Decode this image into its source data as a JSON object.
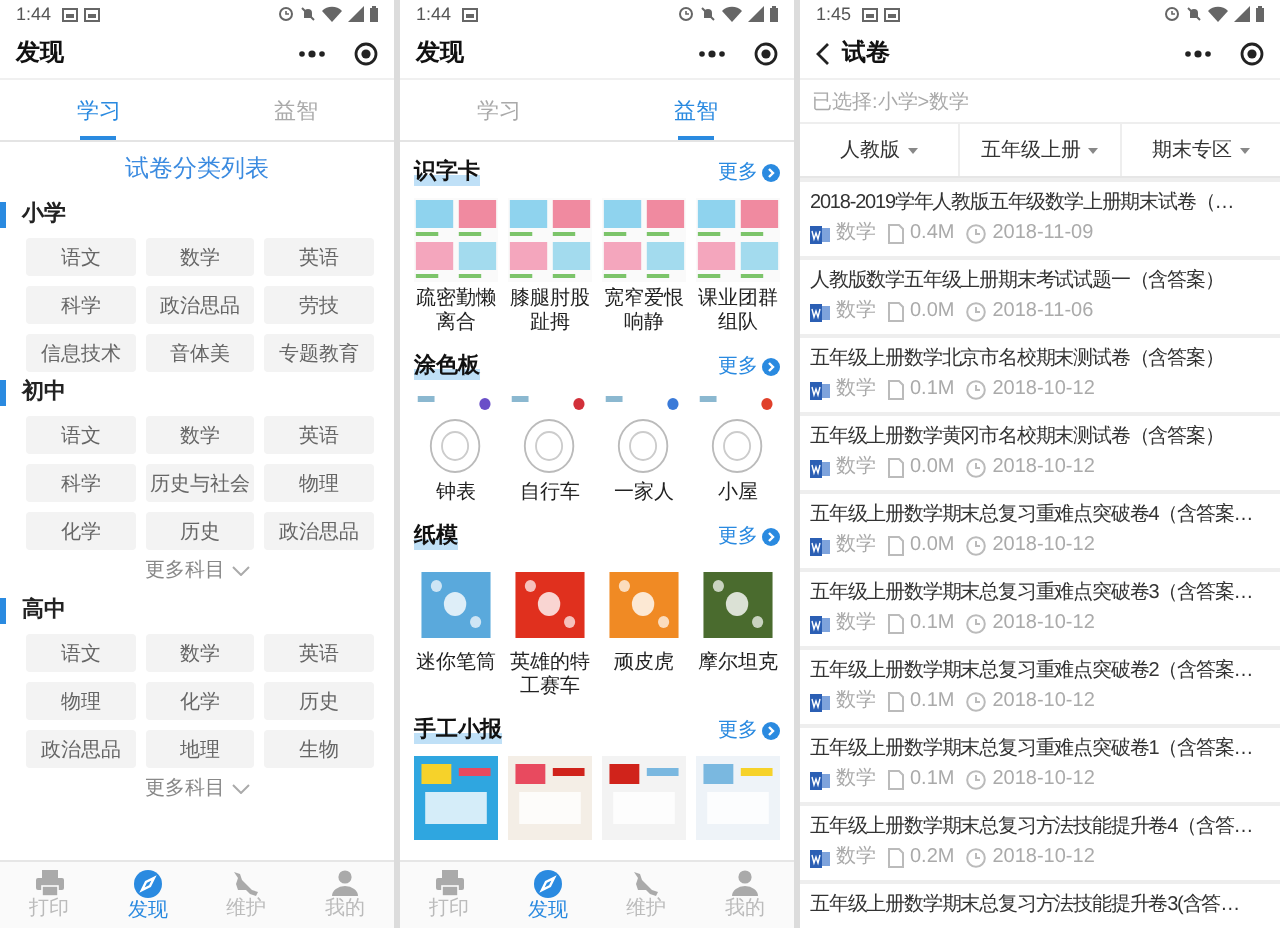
{
  "screens": [
    {
      "kind": "study",
      "status_bar": {
        "time": "1:44",
        "notices": [
          {
            "kind": "gallery"
          },
          {
            "kind": "gallery"
          }
        ]
      },
      "nav": {
        "title": "发现"
      },
      "tabs": [
        {
          "label": "学习",
          "selected": true
        },
        {
          "label": "益智",
          "selected": false
        }
      ],
      "heading": "试卷分类列表",
      "sections": [
        {
          "title": "小学",
          "subjects": [
            "语文",
            "数学",
            "英语",
            "科学",
            "政治思品",
            "劳技",
            "信息技术",
            "音体美",
            "专题教育"
          ]
        },
        {
          "title": "初中",
          "subjects": [
            "语文",
            "数学",
            "英语",
            "科学",
            "历史与社会",
            "物理",
            "化学",
            "历史",
            "政治思品"
          ],
          "more": "更多科目"
        },
        {
          "title": "高中",
          "subjects": [
            "语文",
            "数学",
            "英语",
            "物理",
            "化学",
            "历史",
            "政治思品",
            "地理",
            "生物"
          ],
          "more": "更多科目"
        }
      ],
      "bottom_tabs": [
        {
          "label": "打印",
          "selected": false
        },
        {
          "label": "发现",
          "selected": true
        },
        {
          "label": "维护",
          "selected": false
        },
        {
          "label": "我的",
          "selected": false
        }
      ]
    },
    {
      "kind": "puzzle",
      "status_bar": {
        "time": "1:44",
        "notices": [
          {
            "kind": "gallery"
          }
        ]
      },
      "nav": {
        "title": "发现"
      },
      "tabs": [
        {
          "label": "学习",
          "selected": false
        },
        {
          "label": "益智",
          "selected": true
        }
      ],
      "categories": [
        {
          "title": "识字卡",
          "more": "更多",
          "items": [
            {
              "kind": "picture",
              "label": "疏密勤懒离合"
            },
            {
              "kind": "picture",
              "label": "膝腿肘股趾拇"
            },
            {
              "kind": "picture",
              "label": "宽窄爱恨响静"
            },
            {
              "kind": "picture",
              "label": "课业团群组队"
            }
          ]
        },
        {
          "title": "涂色板",
          "more": "更多",
          "items": [
            {
              "kind": "picture",
              "label": "钟表"
            },
            {
              "kind": "picture",
              "label": "自行车"
            },
            {
              "kind": "picture",
              "label": "一家人"
            },
            {
              "kind": "picture",
              "label": "小屋"
            }
          ]
        },
        {
          "title": "纸模",
          "more": "更多",
          "items": [
            {
              "kind": "picture",
              "label": "迷你笔筒"
            },
            {
              "kind": "picture",
              "label": "英雄的特工赛车"
            },
            {
              "kind": "picture",
              "label": "顽皮虎"
            },
            {
              "kind": "picture",
              "label": "摩尔坦克"
            }
          ]
        },
        {
          "title": "手工小报",
          "more": "更多"
        }
      ],
      "bottom_tabs": [
        {
          "label": "打印",
          "selected": false
        },
        {
          "label": "发现",
          "selected": true
        },
        {
          "label": "维护",
          "selected": false
        },
        {
          "label": "我的",
          "selected": false
        }
      ]
    },
    {
      "kind": "papers",
      "status_bar": {
        "time": "1:45",
        "notices": [
          {
            "kind": "gallery"
          },
          {
            "kind": "gallery"
          }
        ]
      },
      "nav": {
        "title": "试卷",
        "back": true
      },
      "selection": "已选择:小学>数学",
      "filters": [
        "人教版",
        "五年级上册",
        "期末专区"
      ],
      "files": [
        {
          "title": "2018-2019学年人教版五年级数学上册期末试卷（…",
          "subject": "数学",
          "size": "0.4M",
          "date": "2018-11-09"
        },
        {
          "title": "人教版数学五年级上册期末考试试题一（含答案）",
          "subject": "数学",
          "size": "0.0M",
          "date": "2018-11-06"
        },
        {
          "title": "五年级上册数学北京市名校期末测试卷（含答案）",
          "subject": "数学",
          "size": "0.1M",
          "date": "2018-10-12"
        },
        {
          "title": "五年级上册数学黄冈市名校期末测试卷（含答案）",
          "subject": "数学",
          "size": "0.0M",
          "date": "2018-10-12"
        },
        {
          "title": "五年级上册数学期末总复习重难点突破卷4（含答案…",
          "subject": "数学",
          "size": "0.0M",
          "date": "2018-10-12"
        },
        {
          "title": "五年级上册数学期末总复习重难点突破卷3（含答案…",
          "subject": "数学",
          "size": "0.1M",
          "date": "2018-10-12"
        },
        {
          "title": "五年级上册数学期末总复习重难点突破卷2（含答案…",
          "subject": "数学",
          "size": "0.1M",
          "date": "2018-10-12"
        },
        {
          "title": "五年级上册数学期末总复习重难点突破卷1（含答案…",
          "subject": "数学",
          "size": "0.1M",
          "date": "2018-10-12"
        },
        {
          "title": "五年级上册数学期末总复习方法技能提升卷4（含答…",
          "subject": "数学",
          "size": "0.2M",
          "date": "2018-10-12"
        },
        {
          "title": "五年级上册数学期末总复习方法技能提升卷3(含答…"
        }
      ]
    }
  ]
}
